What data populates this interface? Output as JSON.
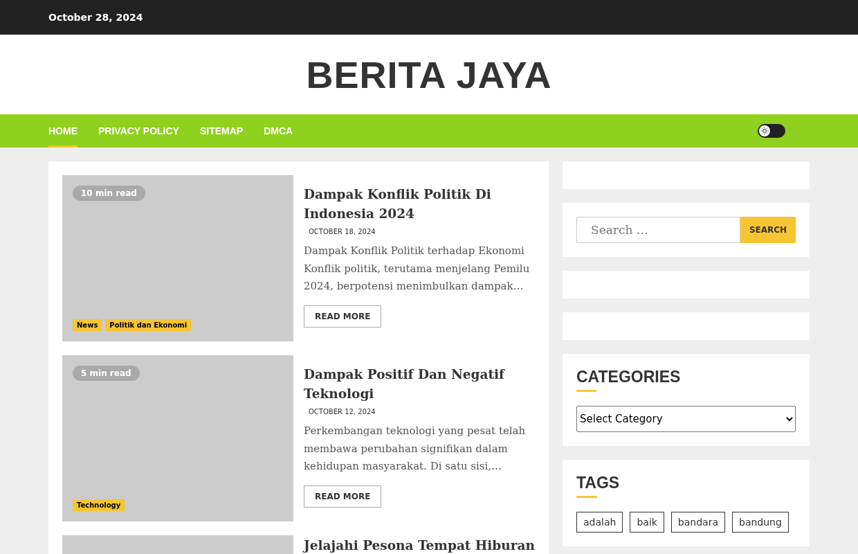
{
  "top_bar": {
    "date": "October 28, 2024"
  },
  "site": {
    "title": "BERITA JAYA"
  },
  "nav": {
    "items": [
      {
        "label": "HOME",
        "selected": true
      },
      {
        "label": "PRIVACY POLICY",
        "selected": false
      },
      {
        "label": "SITEMAP",
        "selected": false
      },
      {
        "label": "DMCA",
        "selected": false
      }
    ],
    "dark_mode": {
      "on": false
    }
  },
  "posts": [
    {
      "read_time": "10 min read",
      "categories": [
        "News",
        "Politik dan Ekonomi"
      ],
      "title": "Dampak Konflik Politik Di Indonesia 2024",
      "date": "OCTOBER 18, 2024",
      "excerpt": "Dampak Konflik Politik terhadap Ekonomi Konflik politik, terutama menjelang Pemilu 2024, berpotensi menimbulkan dampak…",
      "button": "READ MORE"
    },
    {
      "read_time": "5 min read",
      "categories": [
        "Technology"
      ],
      "title": "Dampak Positif Dan Negatif Teknologi",
      "date": "OCTOBER 12, 2024",
      "excerpt": "Perkembangan teknologi yang pesat telah membawa perubahan signifikan dalam kehidupan masyarakat. Di satu sisi,…",
      "button": "READ MORE"
    },
    {
      "title": "Jelajahi Pesona Tempat Hiburan"
    }
  ],
  "sidebar": {
    "search": {
      "placeholder": "Search …",
      "button": "SEARCH"
    },
    "categories": {
      "heading": "CATEGORIES",
      "select": "Select Category"
    },
    "tags": {
      "heading": "TAGS",
      "items": [
        "adalah",
        "baik",
        "bandara",
        "bandung"
      ]
    }
  }
}
